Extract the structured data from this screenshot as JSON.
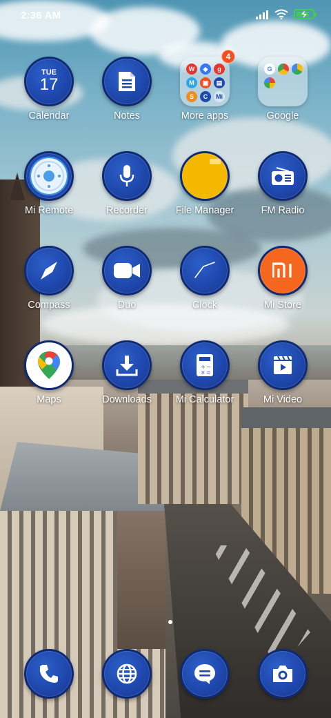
{
  "status_bar": {
    "time": "2:36 AM",
    "icons": [
      "signal-icon",
      "wifi-icon",
      "battery-charging-icon"
    ],
    "battery_color": "#3ecf4b"
  },
  "home": {
    "apps": [
      {
        "label": "Calendar",
        "icon": "calendar-icon",
        "day": "TUE",
        "date": "17"
      },
      {
        "label": "Notes",
        "icon": "notes-icon"
      },
      {
        "label": "More apps",
        "icon": "folder-icon",
        "badge": "4"
      },
      {
        "label": "Google",
        "icon": "folder-icon"
      },
      {
        "label": "Mi Remote",
        "icon": "remote-icon"
      },
      {
        "label": "Recorder",
        "icon": "microphone-icon"
      },
      {
        "label": "File Manager",
        "icon": "folder-yellow-icon"
      },
      {
        "label": "FM Radio",
        "icon": "radio-icon"
      },
      {
        "label": "Compass",
        "icon": "compass-icon"
      },
      {
        "label": "Duo",
        "icon": "video-camera-icon"
      },
      {
        "label": "Clock",
        "icon": "clock-icon"
      },
      {
        "label": "Mi Store",
        "icon": "mi-logo-icon",
        "logo_text": "mi"
      },
      {
        "label": "Maps",
        "icon": "maps-pin-icon"
      },
      {
        "label": "Downloads",
        "icon": "download-icon"
      },
      {
        "label": "Mi Calculator",
        "icon": "calculator-icon"
      },
      {
        "label": "Mi Video",
        "icon": "video-clapper-icon"
      }
    ],
    "folder_more_apps_letters": [
      "g"
    ],
    "folder_google_letters": []
  },
  "dock": {
    "items": [
      "phone-icon",
      "browser-globe-icon",
      "messages-icon",
      "camera-icon"
    ]
  },
  "colors": {
    "icon_blue": "#1f48ad",
    "icon_border": "#0e2a73",
    "badge": "#f0521f",
    "mi_orange": "#f5671f",
    "file_yellow": "#f5b800"
  }
}
